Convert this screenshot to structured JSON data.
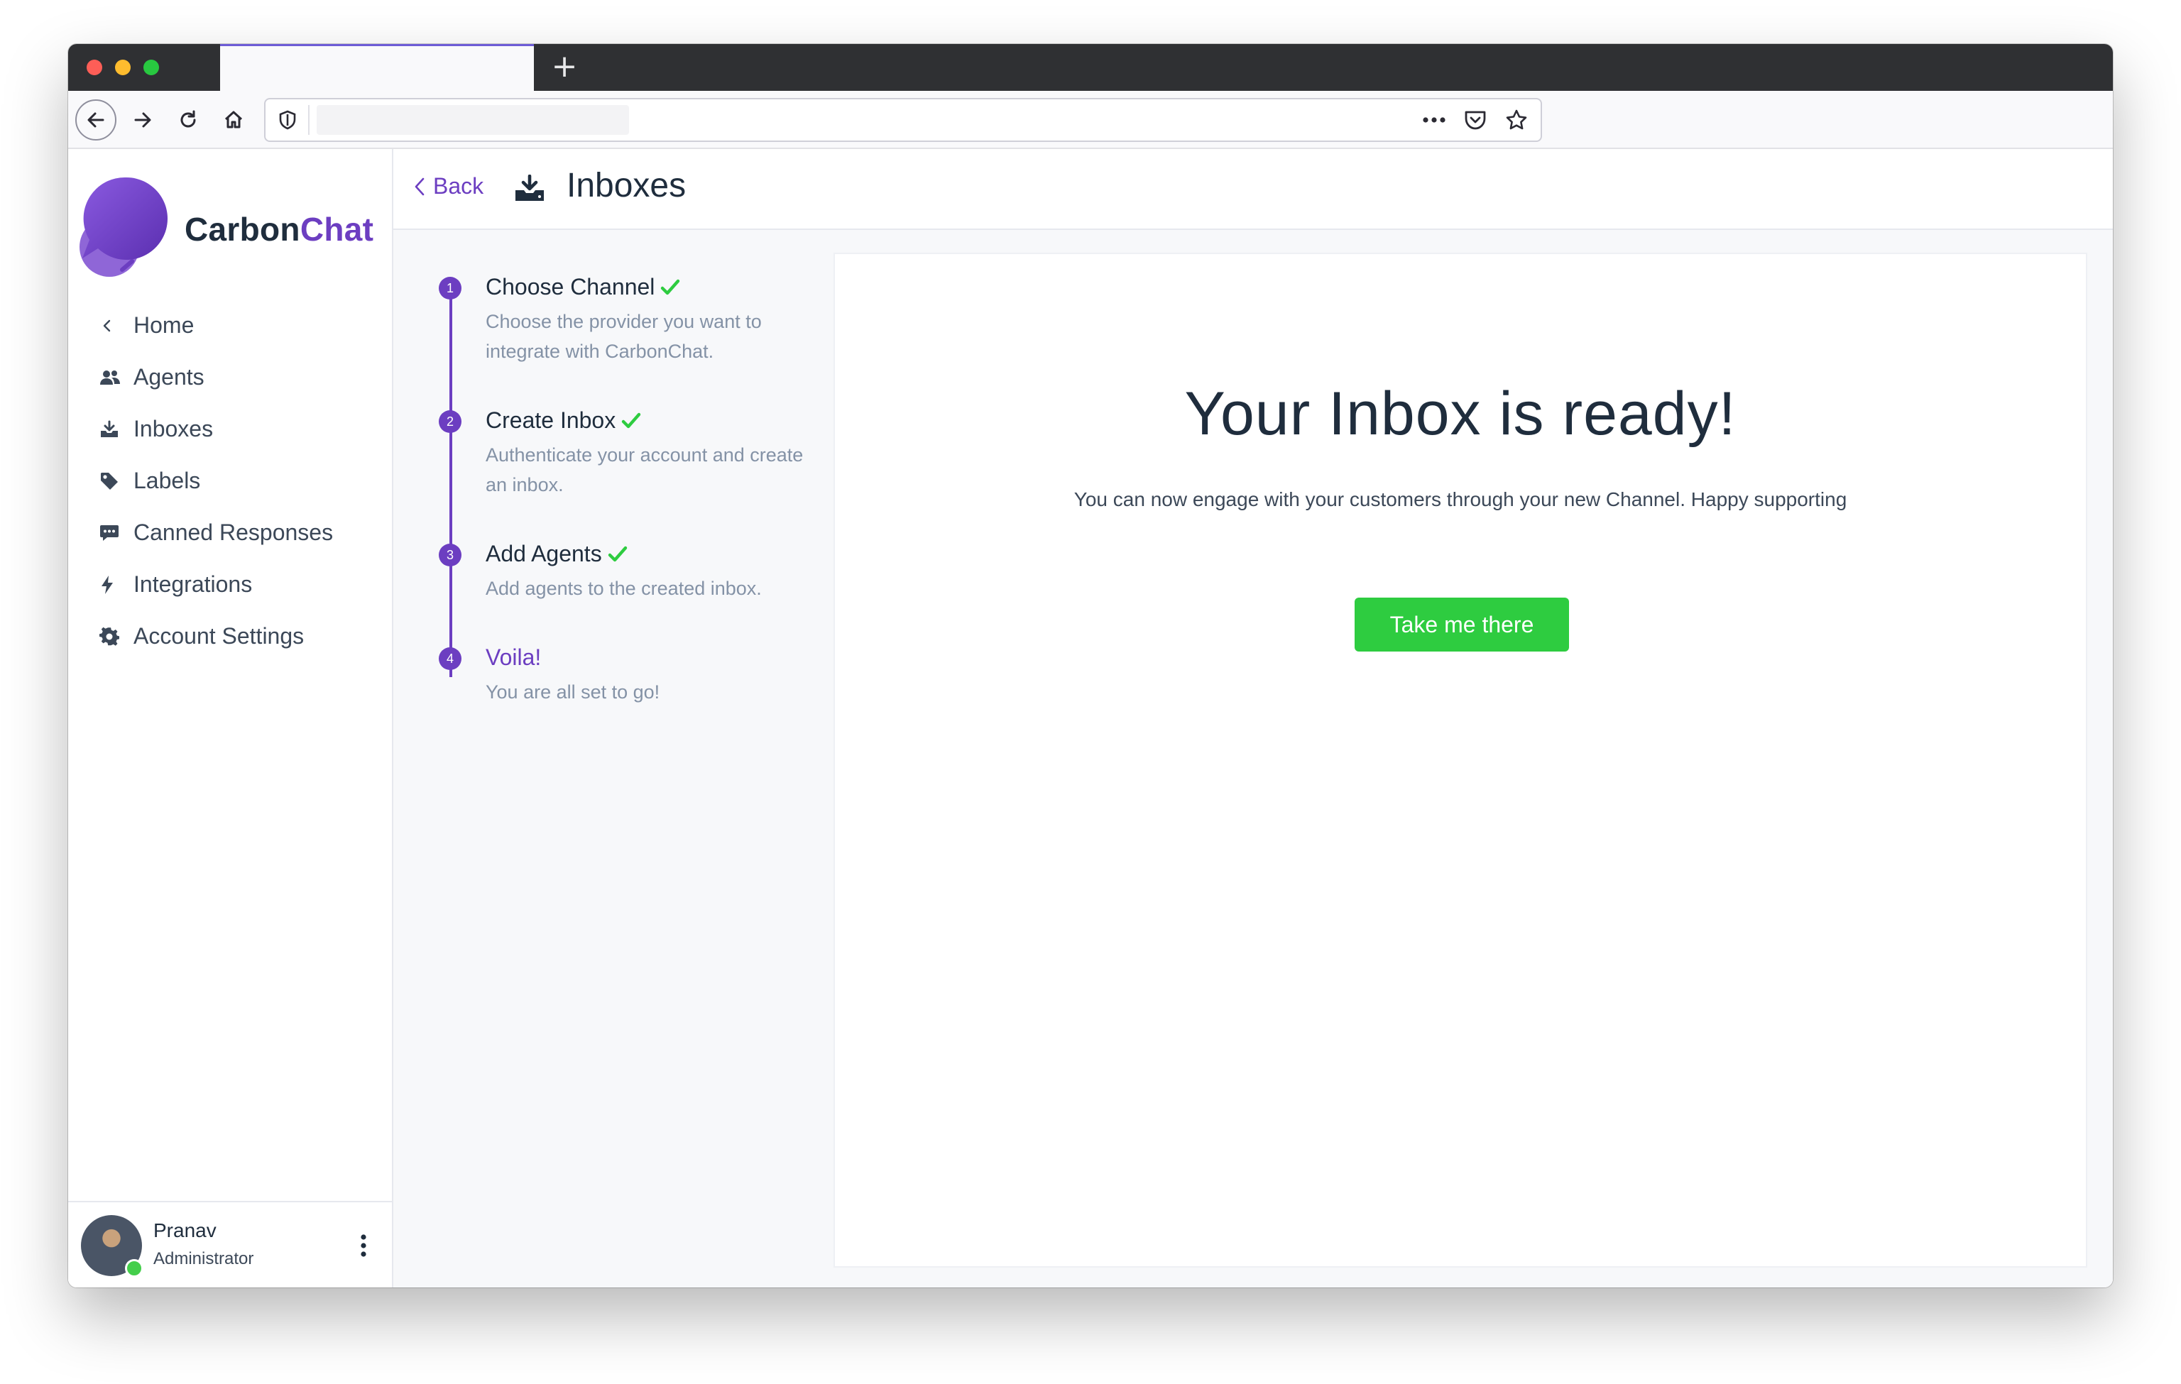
{
  "browser": {
    "new_tab_label": "+",
    "icons": [
      "back-icon",
      "forward-icon",
      "reload-icon",
      "home-icon",
      "shield-icon",
      "more-icon",
      "pocket-icon",
      "bookmark-star-icon"
    ]
  },
  "brand": {
    "name_part1": "Carbon",
    "name_part2": "Chat",
    "accent_color": "#6c3ec1"
  },
  "sidebar": {
    "items": [
      {
        "label": "Home",
        "icon": "chevron-left-icon"
      },
      {
        "label": "Agents",
        "icon": "people-icon"
      },
      {
        "label": "Inboxes",
        "icon": "inbox-download-icon"
      },
      {
        "label": "Labels",
        "icon": "tag-icon"
      },
      {
        "label": "Canned Responses",
        "icon": "chat-bubble-icon"
      },
      {
        "label": "Integrations",
        "icon": "lightning-icon"
      },
      {
        "label": "Account Settings",
        "icon": "gear-icon"
      }
    ],
    "user": {
      "name": "Pranav",
      "role": "Administrator",
      "status_color": "#44ce4b"
    }
  },
  "header": {
    "back_label": "Back",
    "title": "Inboxes",
    "icon": "inbox-download-icon"
  },
  "steps": [
    {
      "number": "1",
      "title": "Choose Channel",
      "description": "Choose the provider you want to integrate with CarbonChat.",
      "completed": true
    },
    {
      "number": "2",
      "title": "Create Inbox",
      "description": "Authenticate your account and create an inbox.",
      "completed": true
    },
    {
      "number": "3",
      "title": "Add Agents",
      "description": "Add agents to the created inbox.",
      "completed": true
    },
    {
      "number": "4",
      "title": "Voila!",
      "description": "You are all set to go!",
      "completed": false
    }
  ],
  "panel": {
    "title": "Your Inbox is ready!",
    "subtitle": "You can now engage with your customers through your new Channel. Happy supporting",
    "button_label": "Take me there",
    "button_color": "#2ecc40"
  }
}
